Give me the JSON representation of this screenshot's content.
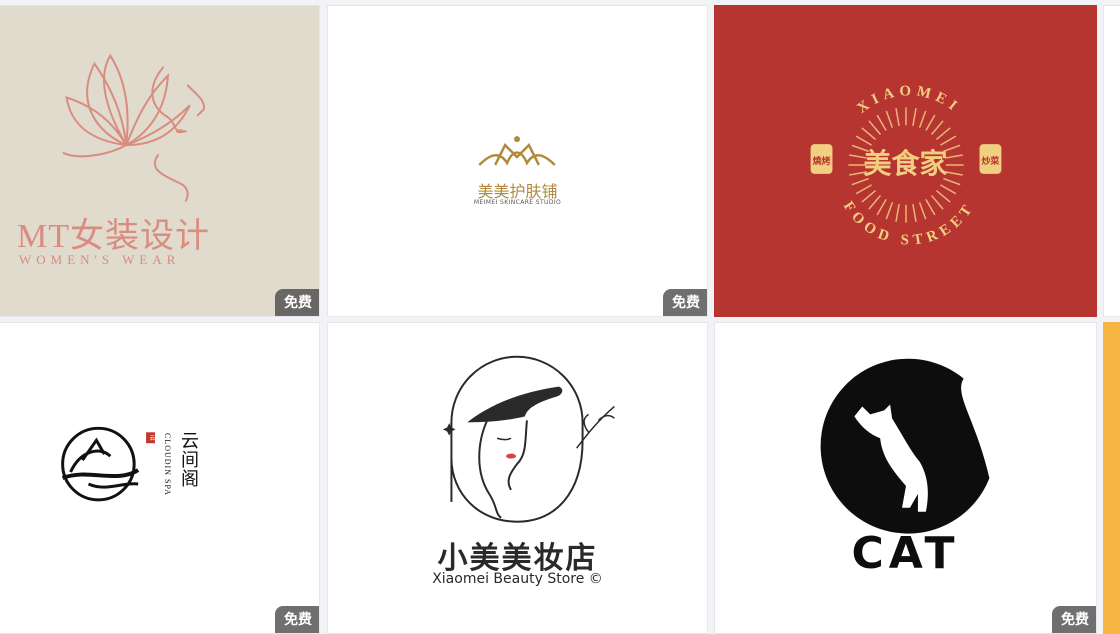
{
  "badge_label": "免费",
  "cards": [
    {
      "id": "mt",
      "title": "MT女装设计",
      "subtitle": "WOMEN'S WEAR",
      "background": "#e0dbcc",
      "accent": "#d98c80",
      "badge": "免费"
    },
    {
      "id": "meimei",
      "title": "美美护肤铺",
      "subtitle": "MEIMEI SKINCARE STUDIO",
      "background": "#ffffff",
      "accent": "#b08a3c",
      "badge": "免费"
    },
    {
      "id": "food",
      "title": "美食家",
      "arc_top": "XIAOMEI",
      "arc_bottom": "FOOD STREET",
      "seal_left": "燒烤",
      "seal_right": "炒菜",
      "background": "#b73531",
      "accent": "#f0cf80"
    },
    {
      "id": "cloud",
      "title": "云间阁",
      "subtitle": "CLOUDIN SPA",
      "seal": "云",
      "background": "#ffffff",
      "accent": "#111111",
      "badge": "免费"
    },
    {
      "id": "beauty",
      "title": "小美美妆店",
      "subtitle": "Xiaomei Beauty Store ©",
      "background": "#ffffff",
      "accent": "#2a2a2a"
    },
    {
      "id": "cat",
      "title": "CAT",
      "background": "#ffffff",
      "accent": "#0d0d0d",
      "badge": "免费"
    }
  ],
  "colors": {
    "page_bg": "#f2f3f6",
    "edge_strip_yellow": "#f7b542"
  },
  "icons": [
    "lotus-face-icon",
    "crown-icon",
    "sun-ray-emblem-icon",
    "cloud-swirl-icon",
    "woman-hat-icon",
    "cat-moon-icon"
  ]
}
